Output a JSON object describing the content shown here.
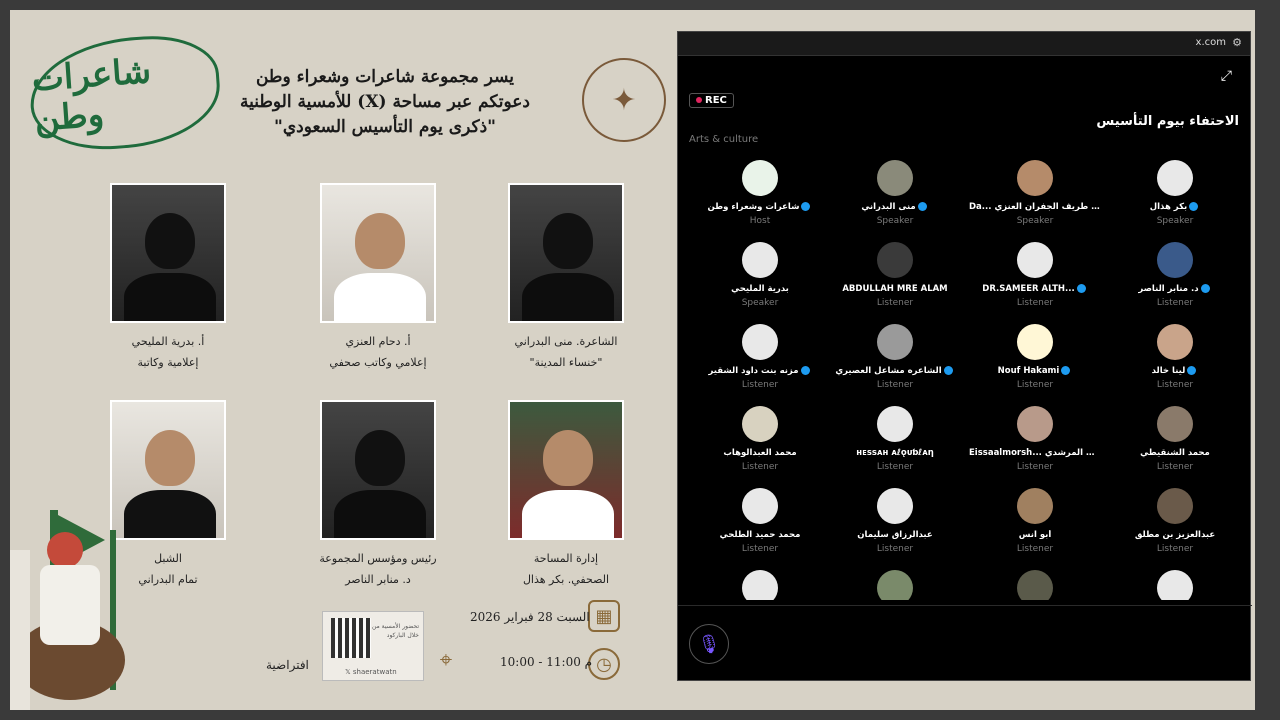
{
  "poster": {
    "logo_left_text": "شاعرات وطن",
    "title_lines": [
      "يسر مجموعة شاعرات وشعراء وطن",
      "دعوتكم عبر مساحة (X) للأمسية الوطنية",
      "\"ذكرى يوم التأسيس السعودي\""
    ],
    "people": [
      {
        "line1": "أ. بدرية المليحي",
        "line2": "إعلامية وكاتبة"
      },
      {
        "line1": "أ. دحام العنزي",
        "line2": "إعلامي وكاتب صحفي"
      },
      {
        "line1": "الشاعرة. منى البدراني",
        "line2": "\"خنساء المدينة\""
      },
      {
        "line1": "الشبل",
        "line2": "تمام البدراني"
      },
      {
        "line1": "رئيس ومؤسس المجموعة",
        "line2": "د. منابر الناصر"
      },
      {
        "line1": "إدارة المساحة",
        "line2": "الصحفي. بكر هذال"
      }
    ],
    "date_text": "السبت 28 فبراير 2026",
    "time_text": "10:00 - 11:00 م",
    "location_text": "افتراضية",
    "qr_text": "تحضور الأمسية من خلال الباركود",
    "qr_handle": "shaeratwatn",
    "calendar_icon": "calendar-icon",
    "clock_icon": "clock-icon",
    "location_icon": "location-pin-icon"
  },
  "panel": {
    "url": "x.com",
    "rec_label": "REC",
    "title": "الاحتفاء بيوم التأسيس",
    "category": "Arts & culture",
    "participants": [
      {
        "name": "بكر هذال",
        "role": "Speaker"
      },
      {
        "name": "Da... دحام طريف الجفران العنزي",
        "role": "Speaker"
      },
      {
        "name": "منى البدراني",
        "role": "Speaker"
      },
      {
        "name": "شاعرات وشعراء وطن",
        "role": "Host"
      },
      {
        "name": "د. منابر الناصر",
        "role": "Listener"
      },
      {
        "name": "DR.SAMEER ALTH...",
        "role": "Listener"
      },
      {
        "name": "ABDULLAH MRE ALAM",
        "role": "Listener"
      },
      {
        "name": "بدرية المليحي",
        "role": "Speaker"
      },
      {
        "name": "لينا خالد",
        "role": "Listener"
      },
      {
        "name": "Nouf Hakami",
        "role": "Listener"
      },
      {
        "name": "الشاعره مشاعل العصيري",
        "role": "Listener"
      },
      {
        "name": "مزنه بنت داود الشقير",
        "role": "Listener"
      },
      {
        "name": "محمد الشنقيطي",
        "role": "Listener"
      },
      {
        "name": "Eissaalmorsh... عيسى المرشدي",
        "role": "Listener"
      },
      {
        "name": "ʜᴇssᴀʜ ᴀℓǫᴜƅℓᴀη",
        "role": "Listener"
      },
      {
        "name": "محمد العبدالوهاب",
        "role": "Listener"
      },
      {
        "name": "عبدالعزيز بن مطلق",
        "role": "Listener"
      },
      {
        "name": "أبو انس",
        "role": "Listener"
      },
      {
        "name": "عبدالرزاق سليمان",
        "role": "Listener"
      },
      {
        "name": "محمد حميد الطلحي",
        "role": "Listener"
      }
    ],
    "mic_icon": "microphone-icon"
  }
}
